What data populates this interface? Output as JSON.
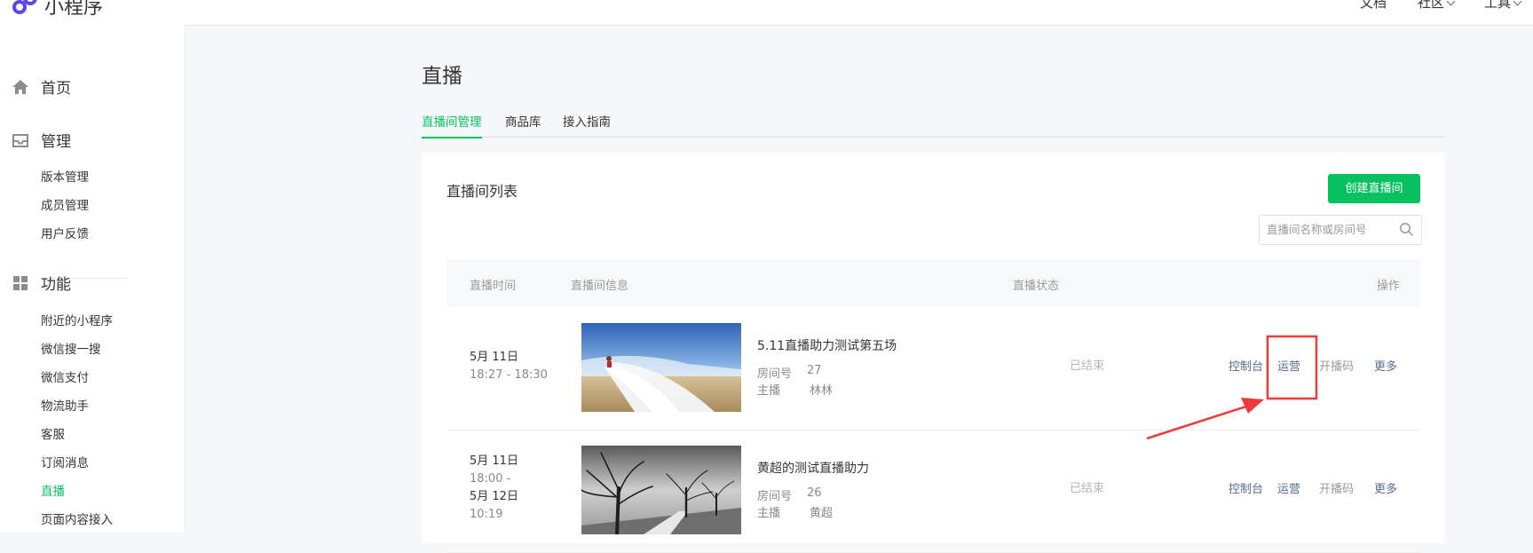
{
  "header": {
    "brand": "小程序",
    "nav": [
      "文档",
      "社区",
      "工具"
    ]
  },
  "sidebar": {
    "sections": [
      {
        "label": "首页",
        "icon": "home-icon"
      },
      {
        "label": "管理",
        "icon": "inbox-icon"
      },
      {
        "label": "功能",
        "icon": "grid-icon"
      }
    ],
    "manage_items": [
      "版本管理",
      "成员管理",
      "用户反馈"
    ],
    "feature_items": [
      "附近的小程序",
      "微信搜一搜",
      "微信支付",
      "物流助手",
      "客服",
      "订阅消息",
      "直播",
      "页面内容接入"
    ],
    "active_item": "直播"
  },
  "main": {
    "title": "直播",
    "tabs": [
      "直播间管理",
      "商品库",
      "接入指南"
    ],
    "active_tab": "直播间管理",
    "list": {
      "title": "直播间列表",
      "create_label": "创建直播间",
      "search_placeholder": "直播间名称或房间号",
      "columns": [
        "直播时间",
        "直播间信息",
        "直播状态",
        "操作"
      ],
      "room_label": "房间号",
      "anchor_label": "主播",
      "rows": [
        {
          "date_lines": [
            "5月 11日",
            "18:27 - 18:30"
          ],
          "title": "5.11直播助力测试第五场",
          "room": "27",
          "anchor": "林林",
          "status": "已结束",
          "thumb": "wedding-dress-field"
        },
        {
          "date_lines": [
            "5月 11日",
            "18:00 -",
            "5月 12日",
            "10:19"
          ],
          "title": "黄超的测试直播助力",
          "room": "26",
          "anchor": "黄超",
          "status": "已结束",
          "thumb": "trees-bw"
        }
      ],
      "actions": [
        "控制台",
        "运营",
        "开播码",
        "更多"
      ]
    }
  },
  "colors": {
    "brand_green": "#07c160",
    "link_blue": "#576b95",
    "annotation_red": "#f03a3a",
    "logo_purple": "#5b46e8"
  }
}
